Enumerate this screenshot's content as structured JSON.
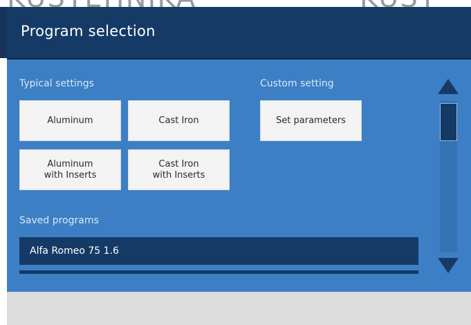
{
  "watermark": {
    "left_text": "KUSTEHNIKA",
    "right_text": "KUST"
  },
  "header": {
    "title": "Program selection"
  },
  "typical": {
    "label": "Typical settings",
    "aluminum": "Aluminum",
    "cast_iron": "Cast Iron",
    "aluminum_inserts": "Aluminum\nwith Inserts",
    "cast_iron_inserts": "Cast Iron\nwith Inserts"
  },
  "custom": {
    "label": "Custom setting",
    "set_parameters": "Set parameters"
  },
  "saved": {
    "label": "Saved programs",
    "items": [
      {
        "label": "Alfa Romeo 75 1.6"
      }
    ]
  },
  "icons": {
    "scroll_up": "triangle-up-icon",
    "scroll_down": "triangle-down-icon"
  },
  "colors": {
    "header": "#153a66",
    "panel": "#3c7fc4",
    "tile": "#f3f3f3",
    "accent_rail": "#e38a2a",
    "footer": "#dcdcdc"
  }
}
